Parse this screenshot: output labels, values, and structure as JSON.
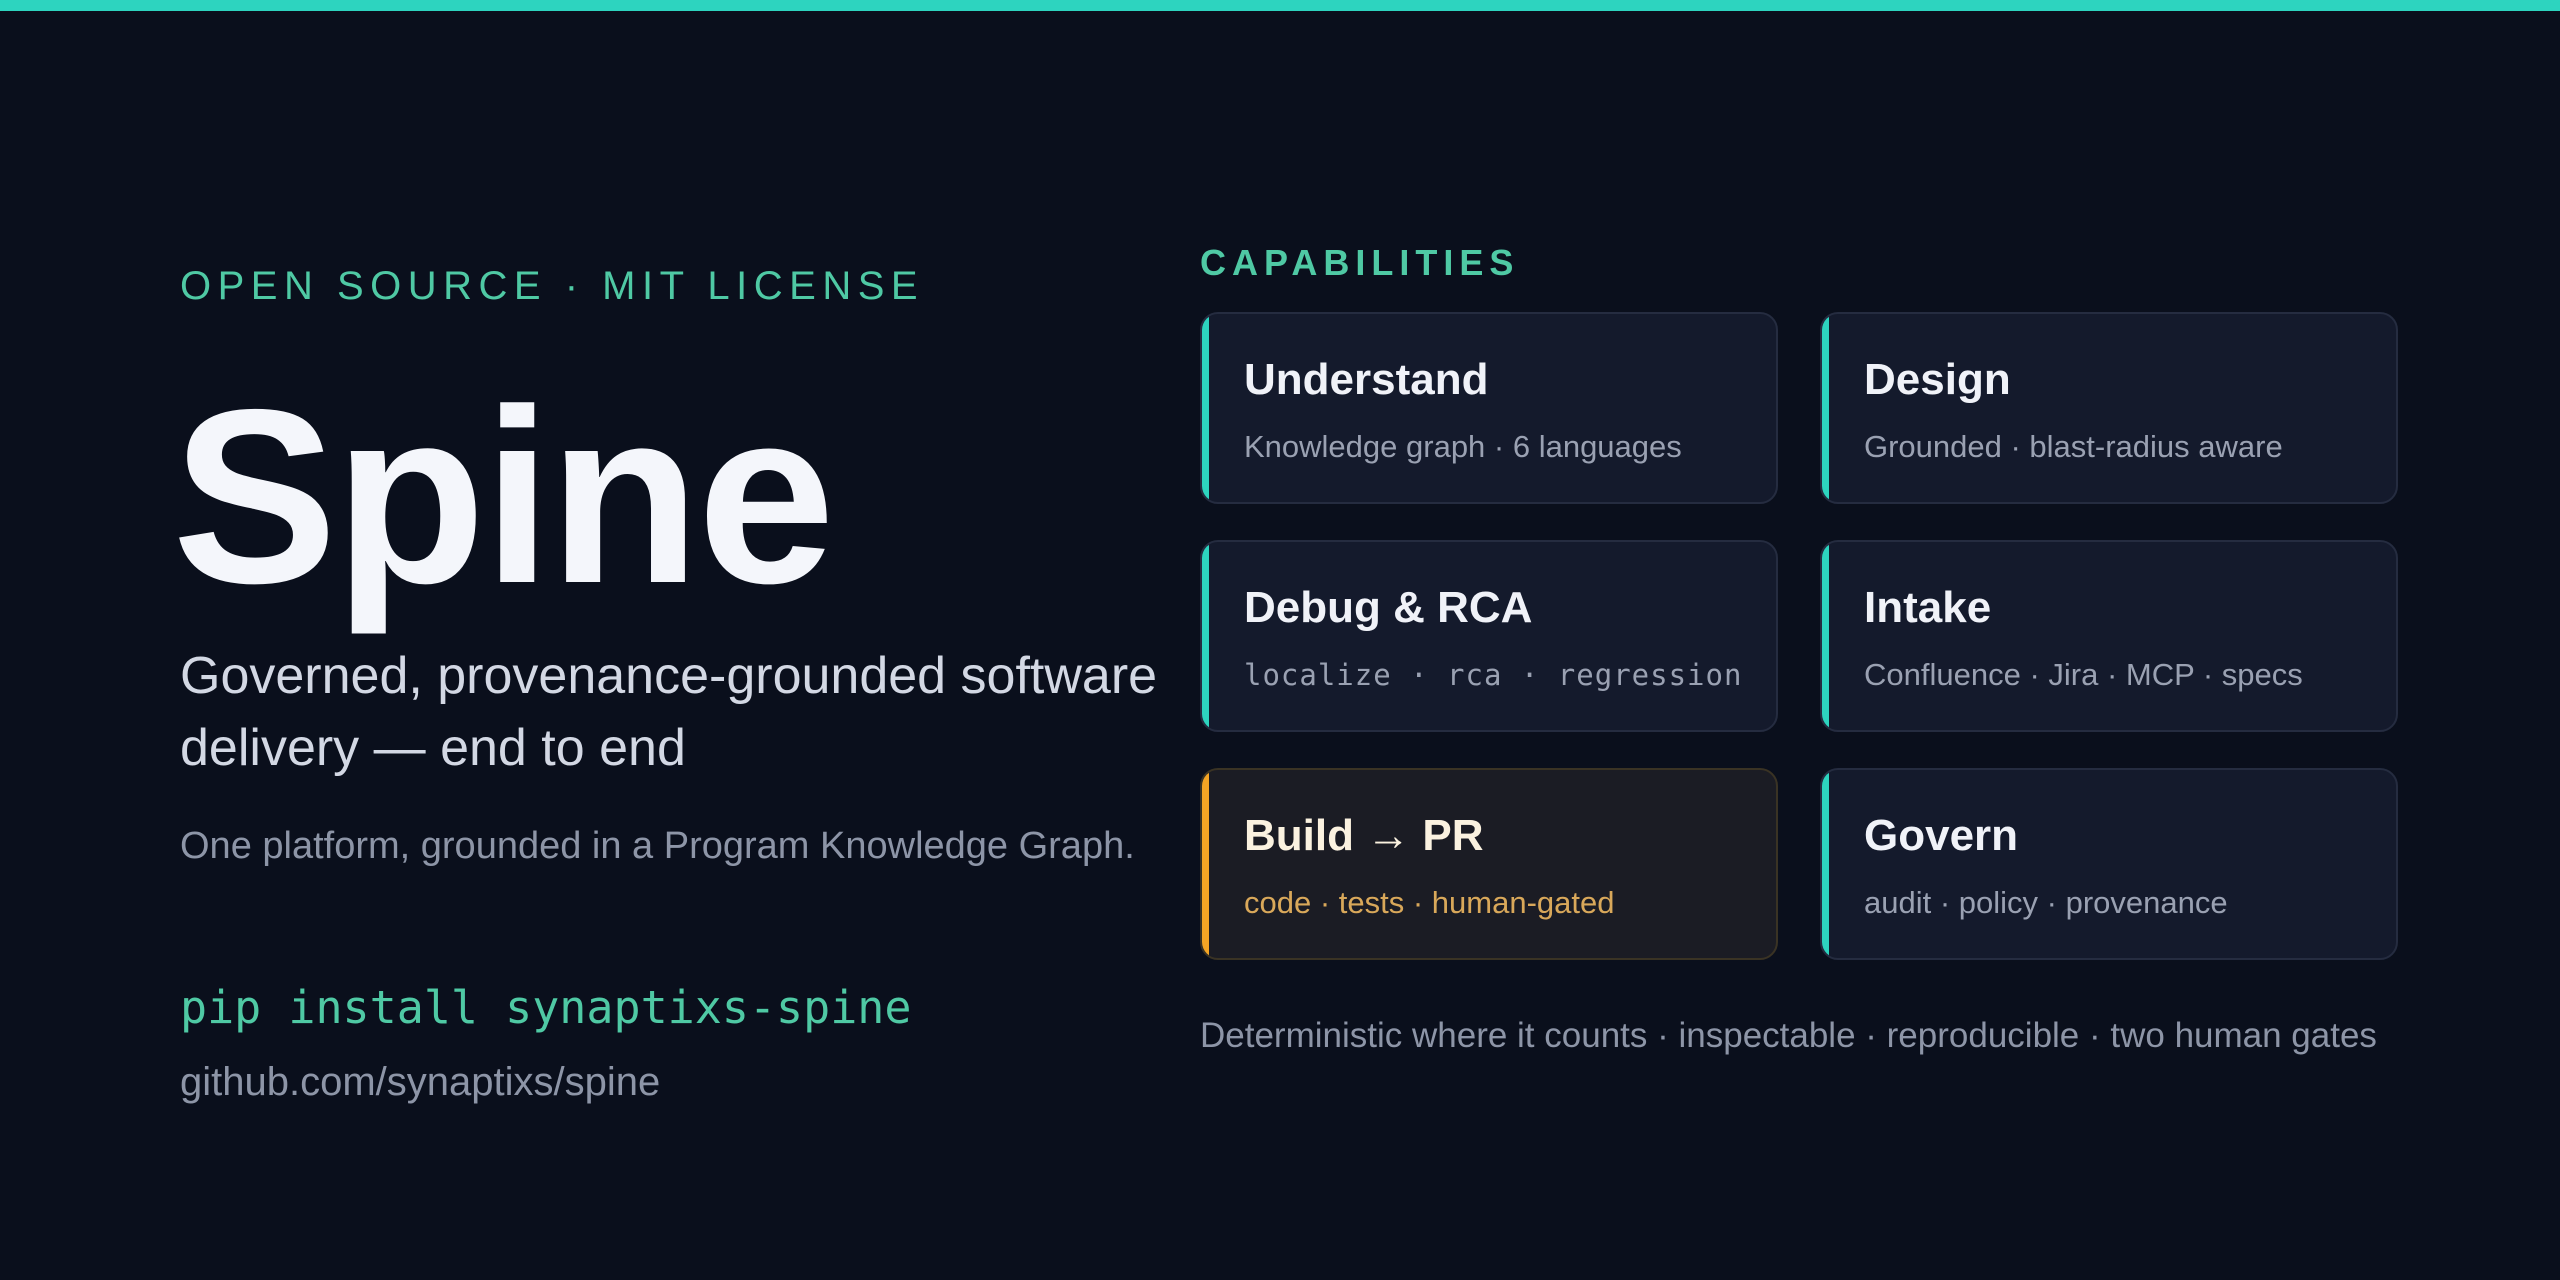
{
  "hero": {
    "eyebrow": "OPEN SOURCE · MIT LICENSE",
    "title": "Spine",
    "subtitle": "Governed, provenance-grounded software delivery — end to end",
    "tagline": "One platform, grounded in a Program Knowledge Graph.",
    "install_command": "pip install synaptixs-spine",
    "repo_url": "github.com/synaptixs/spine"
  },
  "capabilities": {
    "heading": "CAPABILITIES",
    "cards": [
      {
        "title": "Understand",
        "description": "Knowledge graph · 6 languages"
      },
      {
        "title": "Design",
        "description": "Grounded · blast-radius aware"
      },
      {
        "title": "Debug & RCA",
        "description": "localize · rca · regression"
      },
      {
        "title": "Intake",
        "description": "Confluence · Jira · MCP · specs"
      },
      {
        "title": "Build → PR",
        "description": "code · tests · human-gated"
      },
      {
        "title": "Govern",
        "description": "audit · policy · provenance"
      }
    ],
    "footer": "Deterministic where it counts · inspectable · reproducible · two human gates"
  },
  "colors": {
    "background": "#0a0f1c",
    "accent_teal": "#2dd4bf",
    "accent_green_text": "#4fc9a4",
    "accent_amber": "#f5a524"
  }
}
